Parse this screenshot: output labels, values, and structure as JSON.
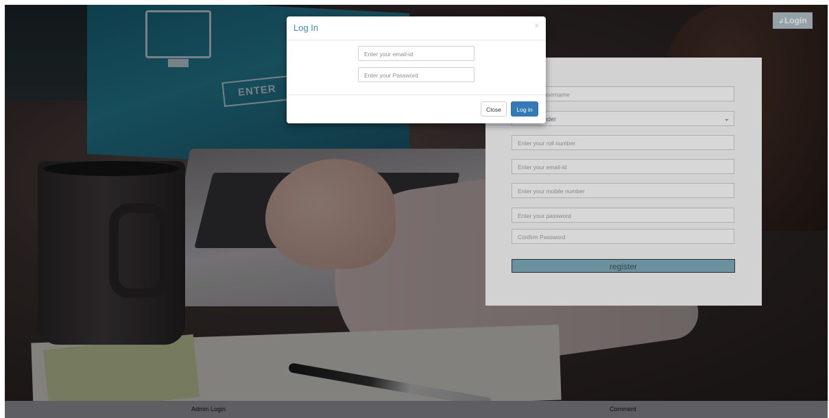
{
  "header": {
    "login_label": "Login",
    "login_icon": "sign-in-icon"
  },
  "register_form": {
    "username_placeholder_visible": "username",
    "gender_visible": "nder",
    "roll_placeholder": "Enter your roll number",
    "email_placeholder": "Enter your email-id",
    "mobile_placeholder": "Enter your mobile number",
    "password_placeholder": "Enter your password",
    "confirm_placeholder": "Confirm Password",
    "register_label": "register"
  },
  "modal": {
    "title": "Log In",
    "close_icon": "×",
    "email_placeholder": "Enter your email-id",
    "password_placeholder": "Enter your Password",
    "close_label": "Close",
    "login_label": "Log in"
  },
  "footer": {
    "admin_login": "Admin Login",
    "comment": "Comment"
  }
}
